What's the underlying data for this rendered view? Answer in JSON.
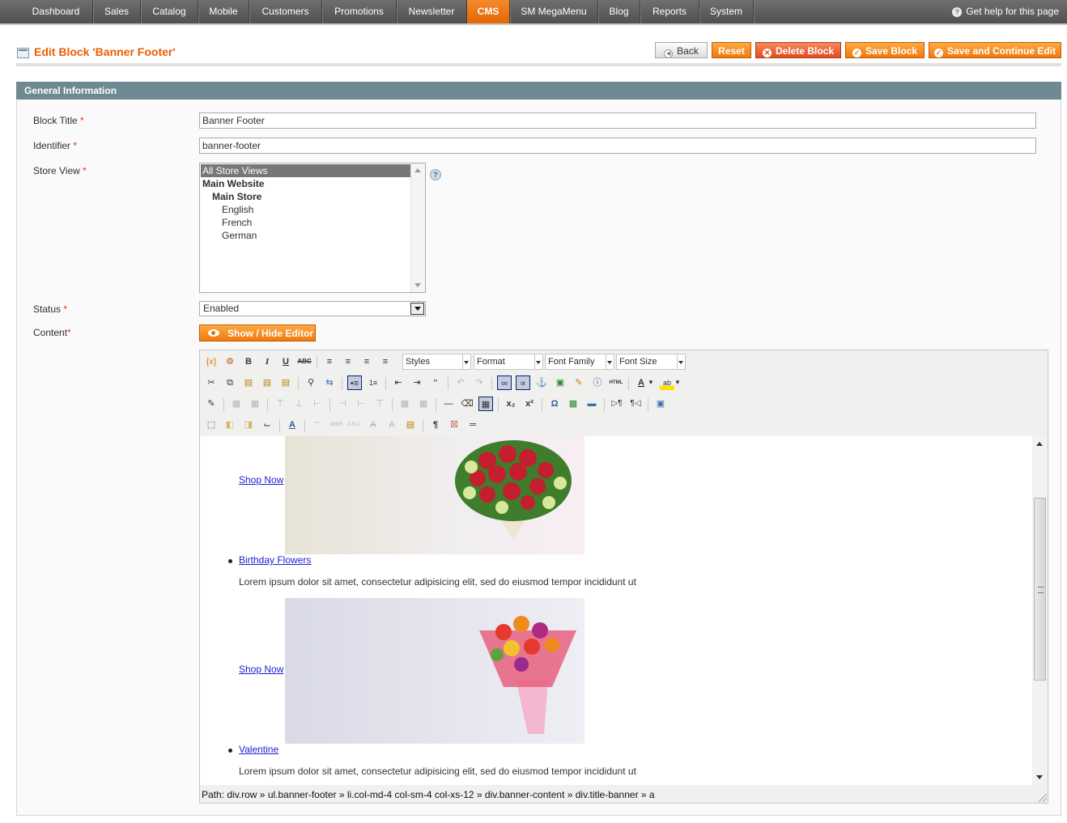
{
  "nav": {
    "items": [
      "Dashboard",
      "Sales",
      "Catalog",
      "Mobile",
      "Customers",
      "Promotions",
      "Newsletter",
      "CMS",
      "SM MegaMenu",
      "Blog",
      "Reports",
      "System"
    ],
    "active": "CMS",
    "help": "Get help for this page"
  },
  "header": {
    "title": "Edit Block 'Banner Footer'",
    "buttons": {
      "back": "Back",
      "reset": "Reset",
      "delete": "Delete Block",
      "save": "Save Block",
      "save_continue": "Save and Continue Edit"
    }
  },
  "fieldset": {
    "title": "General Information",
    "block_title": {
      "label": "Block Title",
      "value": "Banner Footer"
    },
    "identifier": {
      "label": "Identifier",
      "value": "banner-footer"
    },
    "store_view": {
      "label": "Store View",
      "options": [
        "All Store Views",
        "Main Website",
        "Main Store",
        "English",
        "French",
        "German"
      ],
      "selected": "All Store Views"
    },
    "status": {
      "label": "Status",
      "value": "Enabled"
    },
    "content": {
      "label": "Content",
      "toggle": "Show / Hide Editor"
    }
  },
  "editor": {
    "selects": {
      "styles": "Styles",
      "format": "Format",
      "font_family": "Font Family",
      "font_size": "Font Size"
    },
    "body": {
      "shop_now_1": "Shop Now",
      "item_1": "Birthday Flowers",
      "lorem_1": "Lorem ipsum dolor sit amet, consectetur adipisicing elit, sed do eiusmod tempor incididunt ut",
      "shop_now_2": "Shop Now",
      "item_2": "Valentine",
      "lorem_2": "Lorem ipsum dolor sit amet, consectetur adipisicing elit, sed do eiusmod tempor incididunt ut"
    },
    "path": "Path: div.row » ul.banner-footer » li.col-md-4 col-sm-4 col-xs-12 » div.banner-content » div.title-banner » a"
  },
  "colors": {
    "accent": "#eb5e00",
    "nav_active": "#f07a0e",
    "fieldset_header": "#6f8992"
  }
}
